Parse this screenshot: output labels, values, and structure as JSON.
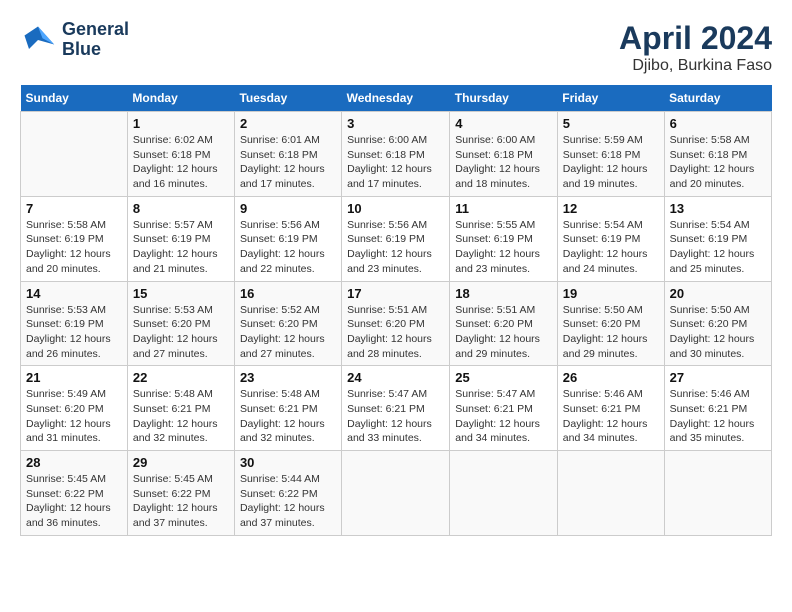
{
  "header": {
    "logo_line1": "General",
    "logo_line2": "Blue",
    "title": "April 2024",
    "subtitle": "Djibo, Burkina Faso"
  },
  "columns": [
    "Sunday",
    "Monday",
    "Tuesday",
    "Wednesday",
    "Thursday",
    "Friday",
    "Saturday"
  ],
  "weeks": [
    [
      {
        "day": "",
        "sunrise": "",
        "sunset": "",
        "daylight": ""
      },
      {
        "day": "1",
        "sunrise": "Sunrise: 6:02 AM",
        "sunset": "Sunset: 6:18 PM",
        "daylight": "Daylight: 12 hours and 16 minutes."
      },
      {
        "day": "2",
        "sunrise": "Sunrise: 6:01 AM",
        "sunset": "Sunset: 6:18 PM",
        "daylight": "Daylight: 12 hours and 17 minutes."
      },
      {
        "day": "3",
        "sunrise": "Sunrise: 6:00 AM",
        "sunset": "Sunset: 6:18 PM",
        "daylight": "Daylight: 12 hours and 17 minutes."
      },
      {
        "day": "4",
        "sunrise": "Sunrise: 6:00 AM",
        "sunset": "Sunset: 6:18 PM",
        "daylight": "Daylight: 12 hours and 18 minutes."
      },
      {
        "day": "5",
        "sunrise": "Sunrise: 5:59 AM",
        "sunset": "Sunset: 6:18 PM",
        "daylight": "Daylight: 12 hours and 19 minutes."
      },
      {
        "day": "6",
        "sunrise": "Sunrise: 5:58 AM",
        "sunset": "Sunset: 6:18 PM",
        "daylight": "Daylight: 12 hours and 20 minutes."
      }
    ],
    [
      {
        "day": "7",
        "sunrise": "Sunrise: 5:58 AM",
        "sunset": "Sunset: 6:19 PM",
        "daylight": "Daylight: 12 hours and 20 minutes."
      },
      {
        "day": "8",
        "sunrise": "Sunrise: 5:57 AM",
        "sunset": "Sunset: 6:19 PM",
        "daylight": "Daylight: 12 hours and 21 minutes."
      },
      {
        "day": "9",
        "sunrise": "Sunrise: 5:56 AM",
        "sunset": "Sunset: 6:19 PM",
        "daylight": "Daylight: 12 hours and 22 minutes."
      },
      {
        "day": "10",
        "sunrise": "Sunrise: 5:56 AM",
        "sunset": "Sunset: 6:19 PM",
        "daylight": "Daylight: 12 hours and 23 minutes."
      },
      {
        "day": "11",
        "sunrise": "Sunrise: 5:55 AM",
        "sunset": "Sunset: 6:19 PM",
        "daylight": "Daylight: 12 hours and 23 minutes."
      },
      {
        "day": "12",
        "sunrise": "Sunrise: 5:54 AM",
        "sunset": "Sunset: 6:19 PM",
        "daylight": "Daylight: 12 hours and 24 minutes."
      },
      {
        "day": "13",
        "sunrise": "Sunrise: 5:54 AM",
        "sunset": "Sunset: 6:19 PM",
        "daylight": "Daylight: 12 hours and 25 minutes."
      }
    ],
    [
      {
        "day": "14",
        "sunrise": "Sunrise: 5:53 AM",
        "sunset": "Sunset: 6:19 PM",
        "daylight": "Daylight: 12 hours and 26 minutes."
      },
      {
        "day": "15",
        "sunrise": "Sunrise: 5:53 AM",
        "sunset": "Sunset: 6:20 PM",
        "daylight": "Daylight: 12 hours and 27 minutes."
      },
      {
        "day": "16",
        "sunrise": "Sunrise: 5:52 AM",
        "sunset": "Sunset: 6:20 PM",
        "daylight": "Daylight: 12 hours and 27 minutes."
      },
      {
        "day": "17",
        "sunrise": "Sunrise: 5:51 AM",
        "sunset": "Sunset: 6:20 PM",
        "daylight": "Daylight: 12 hours and 28 minutes."
      },
      {
        "day": "18",
        "sunrise": "Sunrise: 5:51 AM",
        "sunset": "Sunset: 6:20 PM",
        "daylight": "Daylight: 12 hours and 29 minutes."
      },
      {
        "day": "19",
        "sunrise": "Sunrise: 5:50 AM",
        "sunset": "Sunset: 6:20 PM",
        "daylight": "Daylight: 12 hours and 29 minutes."
      },
      {
        "day": "20",
        "sunrise": "Sunrise: 5:50 AM",
        "sunset": "Sunset: 6:20 PM",
        "daylight": "Daylight: 12 hours and 30 minutes."
      }
    ],
    [
      {
        "day": "21",
        "sunrise": "Sunrise: 5:49 AM",
        "sunset": "Sunset: 6:20 PM",
        "daylight": "Daylight: 12 hours and 31 minutes."
      },
      {
        "day": "22",
        "sunrise": "Sunrise: 5:48 AM",
        "sunset": "Sunset: 6:21 PM",
        "daylight": "Daylight: 12 hours and 32 minutes."
      },
      {
        "day": "23",
        "sunrise": "Sunrise: 5:48 AM",
        "sunset": "Sunset: 6:21 PM",
        "daylight": "Daylight: 12 hours and 32 minutes."
      },
      {
        "day": "24",
        "sunrise": "Sunrise: 5:47 AM",
        "sunset": "Sunset: 6:21 PM",
        "daylight": "Daylight: 12 hours and 33 minutes."
      },
      {
        "day": "25",
        "sunrise": "Sunrise: 5:47 AM",
        "sunset": "Sunset: 6:21 PM",
        "daylight": "Daylight: 12 hours and 34 minutes."
      },
      {
        "day": "26",
        "sunrise": "Sunrise: 5:46 AM",
        "sunset": "Sunset: 6:21 PM",
        "daylight": "Daylight: 12 hours and 34 minutes."
      },
      {
        "day": "27",
        "sunrise": "Sunrise: 5:46 AM",
        "sunset": "Sunset: 6:21 PM",
        "daylight": "Daylight: 12 hours and 35 minutes."
      }
    ],
    [
      {
        "day": "28",
        "sunrise": "Sunrise: 5:45 AM",
        "sunset": "Sunset: 6:22 PM",
        "daylight": "Daylight: 12 hours and 36 minutes."
      },
      {
        "day": "29",
        "sunrise": "Sunrise: 5:45 AM",
        "sunset": "Sunset: 6:22 PM",
        "daylight": "Daylight: 12 hours and 37 minutes."
      },
      {
        "day": "30",
        "sunrise": "Sunrise: 5:44 AM",
        "sunset": "Sunset: 6:22 PM",
        "daylight": "Daylight: 12 hours and 37 minutes."
      },
      {
        "day": "",
        "sunrise": "",
        "sunset": "",
        "daylight": ""
      },
      {
        "day": "",
        "sunrise": "",
        "sunset": "",
        "daylight": ""
      },
      {
        "day": "",
        "sunrise": "",
        "sunset": "",
        "daylight": ""
      },
      {
        "day": "",
        "sunrise": "",
        "sunset": "",
        "daylight": ""
      }
    ]
  ]
}
